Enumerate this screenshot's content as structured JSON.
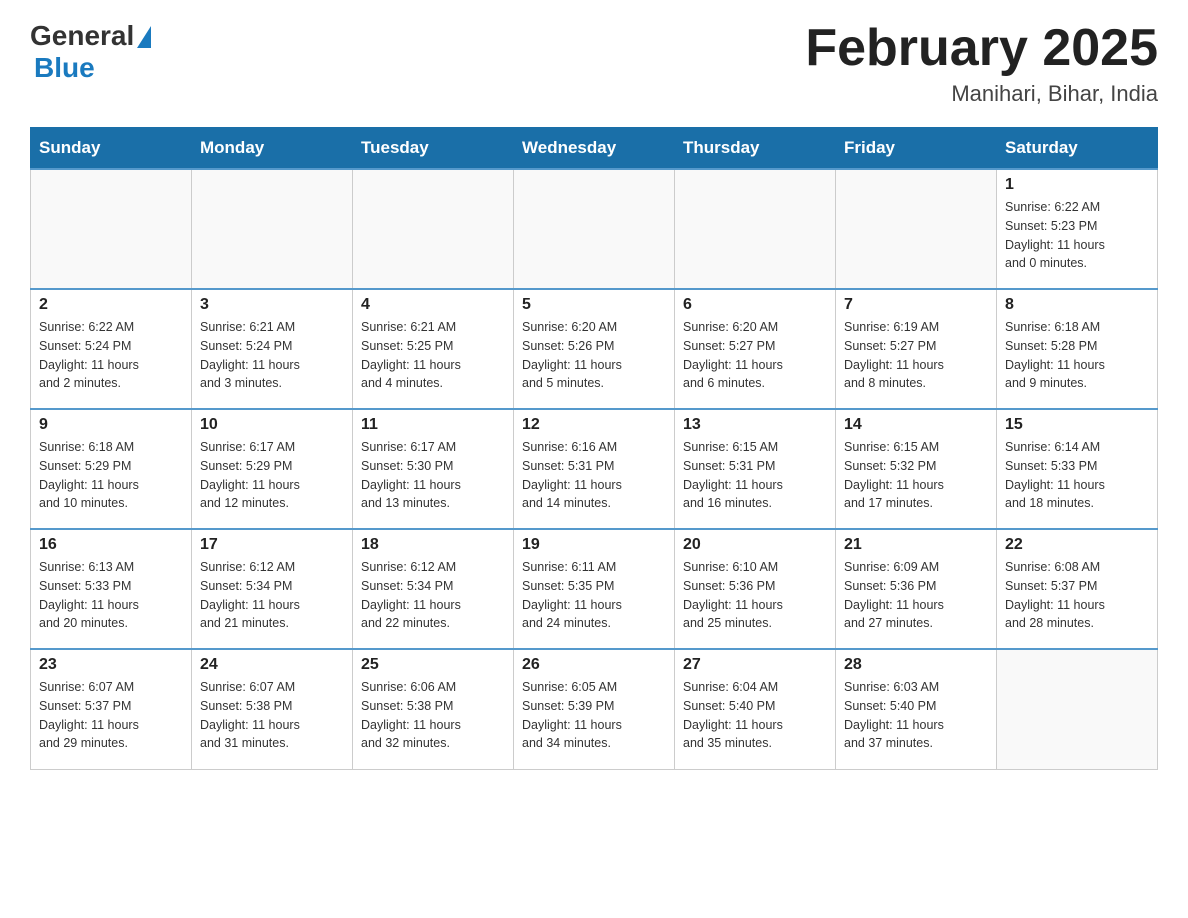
{
  "header": {
    "logo_general": "General",
    "logo_blue": "Blue",
    "month_title": "February 2025",
    "location": "Manihari, Bihar, India"
  },
  "days_of_week": [
    "Sunday",
    "Monday",
    "Tuesday",
    "Wednesday",
    "Thursday",
    "Friday",
    "Saturday"
  ],
  "weeks": [
    [
      {
        "day": "",
        "info": ""
      },
      {
        "day": "",
        "info": ""
      },
      {
        "day": "",
        "info": ""
      },
      {
        "day": "",
        "info": ""
      },
      {
        "day": "",
        "info": ""
      },
      {
        "day": "",
        "info": ""
      },
      {
        "day": "1",
        "info": "Sunrise: 6:22 AM\nSunset: 5:23 PM\nDaylight: 11 hours\nand 0 minutes."
      }
    ],
    [
      {
        "day": "2",
        "info": "Sunrise: 6:22 AM\nSunset: 5:24 PM\nDaylight: 11 hours\nand 2 minutes."
      },
      {
        "day": "3",
        "info": "Sunrise: 6:21 AM\nSunset: 5:24 PM\nDaylight: 11 hours\nand 3 minutes."
      },
      {
        "day": "4",
        "info": "Sunrise: 6:21 AM\nSunset: 5:25 PM\nDaylight: 11 hours\nand 4 minutes."
      },
      {
        "day": "5",
        "info": "Sunrise: 6:20 AM\nSunset: 5:26 PM\nDaylight: 11 hours\nand 5 minutes."
      },
      {
        "day": "6",
        "info": "Sunrise: 6:20 AM\nSunset: 5:27 PM\nDaylight: 11 hours\nand 6 minutes."
      },
      {
        "day": "7",
        "info": "Sunrise: 6:19 AM\nSunset: 5:27 PM\nDaylight: 11 hours\nand 8 minutes."
      },
      {
        "day": "8",
        "info": "Sunrise: 6:18 AM\nSunset: 5:28 PM\nDaylight: 11 hours\nand 9 minutes."
      }
    ],
    [
      {
        "day": "9",
        "info": "Sunrise: 6:18 AM\nSunset: 5:29 PM\nDaylight: 11 hours\nand 10 minutes."
      },
      {
        "day": "10",
        "info": "Sunrise: 6:17 AM\nSunset: 5:29 PM\nDaylight: 11 hours\nand 12 minutes."
      },
      {
        "day": "11",
        "info": "Sunrise: 6:17 AM\nSunset: 5:30 PM\nDaylight: 11 hours\nand 13 minutes."
      },
      {
        "day": "12",
        "info": "Sunrise: 6:16 AM\nSunset: 5:31 PM\nDaylight: 11 hours\nand 14 minutes."
      },
      {
        "day": "13",
        "info": "Sunrise: 6:15 AM\nSunset: 5:31 PM\nDaylight: 11 hours\nand 16 minutes."
      },
      {
        "day": "14",
        "info": "Sunrise: 6:15 AM\nSunset: 5:32 PM\nDaylight: 11 hours\nand 17 minutes."
      },
      {
        "day": "15",
        "info": "Sunrise: 6:14 AM\nSunset: 5:33 PM\nDaylight: 11 hours\nand 18 minutes."
      }
    ],
    [
      {
        "day": "16",
        "info": "Sunrise: 6:13 AM\nSunset: 5:33 PM\nDaylight: 11 hours\nand 20 minutes."
      },
      {
        "day": "17",
        "info": "Sunrise: 6:12 AM\nSunset: 5:34 PM\nDaylight: 11 hours\nand 21 minutes."
      },
      {
        "day": "18",
        "info": "Sunrise: 6:12 AM\nSunset: 5:34 PM\nDaylight: 11 hours\nand 22 minutes."
      },
      {
        "day": "19",
        "info": "Sunrise: 6:11 AM\nSunset: 5:35 PM\nDaylight: 11 hours\nand 24 minutes."
      },
      {
        "day": "20",
        "info": "Sunrise: 6:10 AM\nSunset: 5:36 PM\nDaylight: 11 hours\nand 25 minutes."
      },
      {
        "day": "21",
        "info": "Sunrise: 6:09 AM\nSunset: 5:36 PM\nDaylight: 11 hours\nand 27 minutes."
      },
      {
        "day": "22",
        "info": "Sunrise: 6:08 AM\nSunset: 5:37 PM\nDaylight: 11 hours\nand 28 minutes."
      }
    ],
    [
      {
        "day": "23",
        "info": "Sunrise: 6:07 AM\nSunset: 5:37 PM\nDaylight: 11 hours\nand 29 minutes."
      },
      {
        "day": "24",
        "info": "Sunrise: 6:07 AM\nSunset: 5:38 PM\nDaylight: 11 hours\nand 31 minutes."
      },
      {
        "day": "25",
        "info": "Sunrise: 6:06 AM\nSunset: 5:38 PM\nDaylight: 11 hours\nand 32 minutes."
      },
      {
        "day": "26",
        "info": "Sunrise: 6:05 AM\nSunset: 5:39 PM\nDaylight: 11 hours\nand 34 minutes."
      },
      {
        "day": "27",
        "info": "Sunrise: 6:04 AM\nSunset: 5:40 PM\nDaylight: 11 hours\nand 35 minutes."
      },
      {
        "day": "28",
        "info": "Sunrise: 6:03 AM\nSunset: 5:40 PM\nDaylight: 11 hours\nand 37 minutes."
      },
      {
        "day": "",
        "info": ""
      }
    ]
  ]
}
